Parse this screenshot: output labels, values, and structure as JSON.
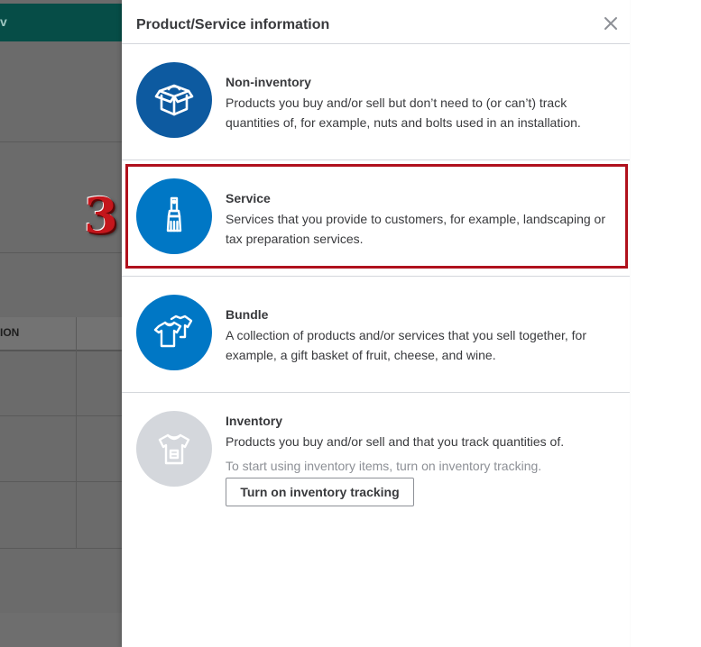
{
  "background": {
    "topbar_text": "v",
    "column_header": "ION"
  },
  "panel": {
    "title": "Product/Service information",
    "close_icon": "close-icon"
  },
  "options": [
    {
      "title": "Non-inventory",
      "description": "Products you buy and/or sell but don’t need to (or can’t) track quantities of, for example, nuts and bolts used in an installation.",
      "icon": "box-icon",
      "color": "#0d5aa0"
    },
    {
      "title": "Service",
      "description": "Services that you provide to customers, for example, landscaping or tax preparation services.",
      "icon": "paintbrush-icon",
      "color": "#0077c5"
    },
    {
      "title": "Bundle",
      "description": "A collection of products and/or services that you sell together, for example, a gift basket of fruit, cheese, and wine.",
      "icon": "shirts-icon",
      "color": "#0077c5"
    },
    {
      "title": "Inventory",
      "description": "Products you buy and/or sell and that you track quantities of.",
      "hint": "To start using inventory items, turn on inventory tracking.",
      "button_label": "Turn on inventory tracking",
      "icon": "shirt-icon",
      "color": "#d4d7dc"
    }
  ],
  "annotation": {
    "step_number": "3",
    "highlight_color": "#b0111d"
  }
}
